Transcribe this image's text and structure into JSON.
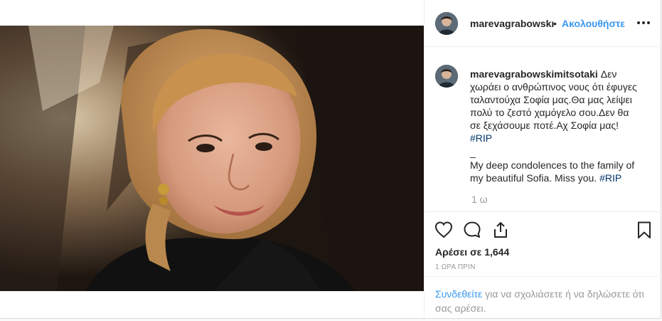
{
  "post": {
    "author": "marevagrabowski",
    "author_display": "marevagrabowskı",
    "dot": "•",
    "follow_label": "Ακολουθήστε",
    "more_icon": "more-options-icon",
    "caption": {
      "username": "marevagrabowskimitsotaki",
      "greek_text": "Δεν χωράει ο ανθρώπινος νους ότι έφυγες ταλαντούχα Σοφία μας.Θα μας λείψει πολύ το ζεστό χαμόγελο σου.Δεν θα σε ξεχάσουμε ποτέ.Αχ Σοφία μας!",
      "greek_hashtag": "#RIP",
      "separator": "_",
      "english_text": "My deep condolences to the family of my beautiful Sofia. Miss you.",
      "english_hashtag": "#RIP",
      "time_ago": "1 ω"
    },
    "actions": {
      "like_icon": "heart-icon",
      "comment_icon": "comment-icon",
      "share_icon": "share-icon",
      "save_icon": "bookmark-icon"
    },
    "likes_text": "Αρέσει σε 1,644",
    "posted_text": "1 ΩΡΑ ΠΡΙΝ",
    "comment_prompt": {
      "link": "Συνδεθείτε",
      "rest": " για να σχολιάσετε ή να δηλώσετε ότι σας αρέσει."
    }
  }
}
